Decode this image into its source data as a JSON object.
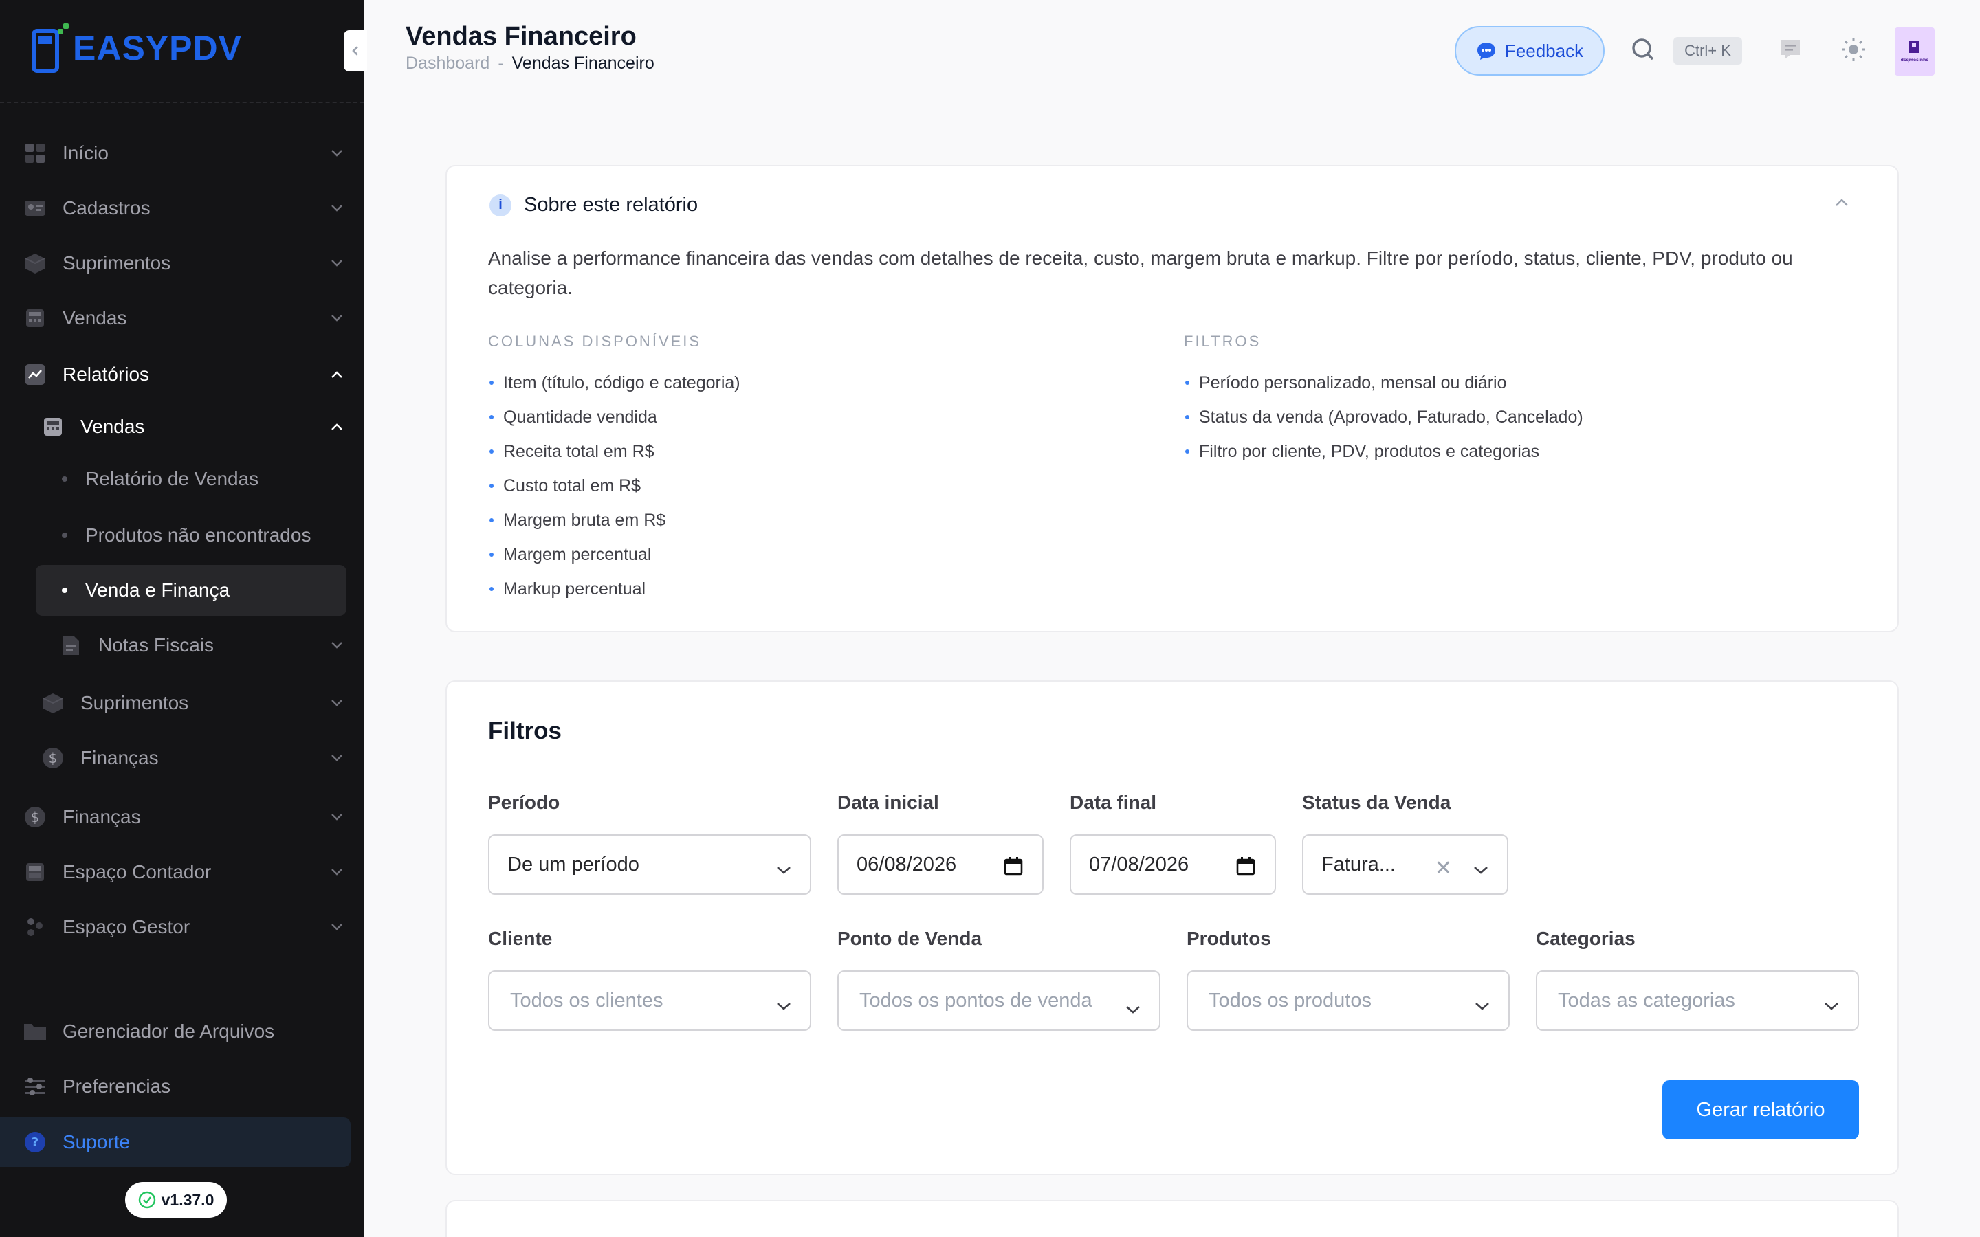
{
  "sidebar": {
    "logo_text": "EASYPDV",
    "items": [
      {
        "label": "Início",
        "icon": "grid-icon"
      },
      {
        "label": "Cadastros",
        "icon": "id-card-icon"
      },
      {
        "label": "Suprimentos",
        "icon": "box-icon"
      },
      {
        "label": "Vendas",
        "icon": "register-icon"
      },
      {
        "label": "Relatórios",
        "icon": "chart-line-icon"
      }
    ],
    "reports_sub": {
      "vendas": "Vendas",
      "relatorio_vendas": "Relatório de Vendas",
      "produtos_nao_encontrados": "Produtos não encontrados",
      "venda_financa": "Venda e Finança",
      "notas_fiscais": "Notas Fiscais",
      "suprimentos": "Suprimentos",
      "financas": "Finanças"
    },
    "bottom_items": [
      {
        "label": "Finanças"
      },
      {
        "label": "Espaço Contador"
      },
      {
        "label": "Espaço Gestor"
      }
    ],
    "gerenciador": "Gerenciador de Arquivos",
    "preferencias": "Preferencias",
    "suporte": "Suporte",
    "version": "v1.37.0"
  },
  "header": {
    "title": "Vendas Financeiro",
    "breadcrumb_root": "Dashboard",
    "breadcrumb_sep": "-",
    "breadcrumb_current": "Vendas Financeiro",
    "feedback_label": "Feedback",
    "shortcut": "Ctrl+ K",
    "avatar_text": "dsqmesinho"
  },
  "about": {
    "title": "Sobre este relatório",
    "description": "Analise a performance financeira das vendas com detalhes de receita, custo, margem bruta e markup. Filtre por período, status, cliente, PDV, produto ou categoria.",
    "columns_title": "COLUNAS DISPONÍVEIS",
    "columns": [
      "Item (título, código e categoria)",
      "Quantidade vendida",
      "Receita total em R$",
      "Custo total em R$",
      "Margem bruta em R$",
      "Margem percentual",
      "Markup percentual"
    ],
    "filters_title": "FILTROS",
    "filters": [
      "Período personalizado, mensal ou diário",
      "Status da venda (Aprovado, Faturado, Cancelado)",
      "Filtro por cliente, PDV, produtos e categorias"
    ]
  },
  "filters": {
    "title": "Filtros",
    "periodo_label": "Período",
    "periodo_value": "De um período",
    "data_inicial_label": "Data inicial",
    "data_inicial_value": "06/08/2026",
    "data_final_label": "Data final",
    "data_final_value": "07/08/2026",
    "status_label": "Status da Venda",
    "status_value": "Fatura...",
    "cliente_label": "Cliente",
    "cliente_placeholder": "Todos os clientes",
    "pdv_label": "Ponto de Venda",
    "pdv_placeholder": "Todos os pontos de venda",
    "produtos_label": "Produtos",
    "produtos_placeholder": "Todos os produtos",
    "categorias_label": "Categorias",
    "categorias_placeholder": "Todas as categorias",
    "generate_label": "Gerar relatório"
  },
  "colors": {
    "sidebar_bg": "#141416",
    "accent": "#1b84ff",
    "brand": "#1e63e8"
  }
}
